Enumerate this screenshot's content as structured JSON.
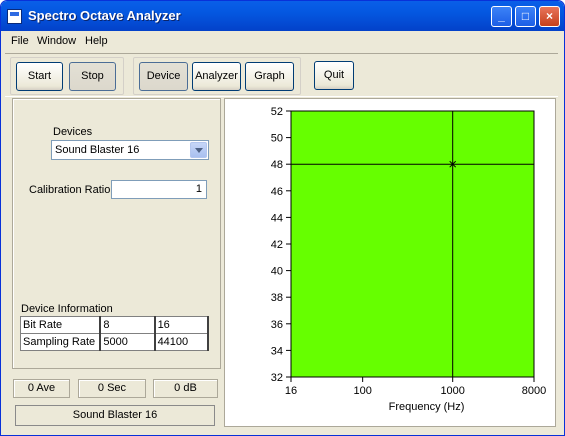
{
  "window": {
    "title": "Spectro Octave Analyzer",
    "min": "_",
    "max": "□",
    "close": "×"
  },
  "menu": [
    "File",
    "Window",
    "Help"
  ],
  "toolbar": {
    "start": "Start",
    "stop": "Stop",
    "device": "Device",
    "analyzer": "Analyzer",
    "graph": "Graph",
    "quit": "Quit"
  },
  "devices": {
    "label": "Devices",
    "selected": "Sound Blaster 16"
  },
  "calibration": {
    "label": "Calibration Ratio",
    "value": "1"
  },
  "device_info": {
    "label": "Device Information",
    "rows": [
      [
        "Bit Rate",
        "8",
        "16"
      ],
      [
        "Sampling Rate",
        "5000",
        "44100"
      ]
    ]
  },
  "status": {
    "ave": "0 Ave",
    "sec": "0 Sec",
    "db": "0 dB"
  },
  "device_bar": "Sound Blaster 16",
  "colors": {
    "plot_fill": "#66ff00",
    "title_bar": "#0457e0"
  },
  "chart_data": {
    "type": "line",
    "xlabel": "Frequency (Hz)",
    "ylabel": "",
    "x_scale": "log",
    "xlim": [
      16,
      8000
    ],
    "ylim": [
      32,
      52
    ],
    "x_ticks": [
      "16",
      "100",
      "1000",
      "8000"
    ],
    "y_ticks": [
      "52",
      "50",
      "48",
      "46",
      "44",
      "42",
      "40",
      "38",
      "36",
      "34",
      "32"
    ],
    "x_tick_values": [
      16,
      100,
      1000,
      8000
    ],
    "y_tick_values": [
      52,
      50,
      48,
      46,
      44,
      42,
      40,
      38,
      36,
      34,
      32
    ],
    "crosshair": {
      "x": 1000,
      "y": 48
    },
    "grid": false,
    "series": []
  }
}
